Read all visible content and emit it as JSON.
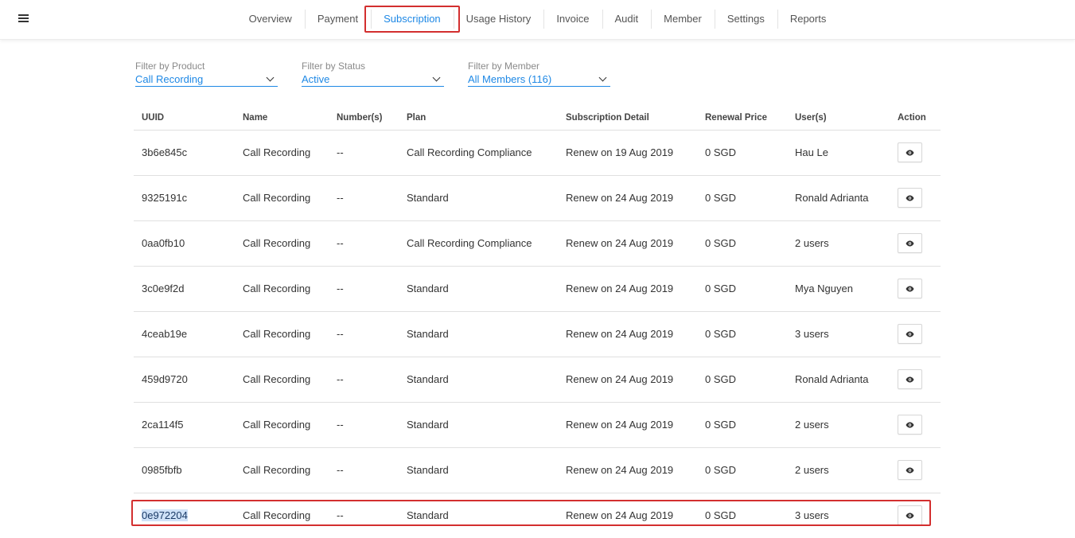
{
  "nav": {
    "tabs": [
      {
        "label": "Overview"
      },
      {
        "label": "Payment"
      },
      {
        "label": "Subscription"
      },
      {
        "label": "Usage History"
      },
      {
        "label": "Invoice"
      },
      {
        "label": "Audit"
      },
      {
        "label": "Member"
      },
      {
        "label": "Settings"
      },
      {
        "label": "Reports"
      }
    ],
    "active_tab": "Subscription"
  },
  "filters": {
    "product": {
      "label": "Filter by Product",
      "value": "Call Recording"
    },
    "status": {
      "label": "Filter by Status",
      "value": "Active"
    },
    "member": {
      "label": "Filter by Member",
      "value": "All Members (116)"
    }
  },
  "table": {
    "headers": {
      "uuid": "UUID",
      "name": "Name",
      "numbers": "Number(s)",
      "plan": "Plan",
      "detail": "Subscription Detail",
      "price": "Renewal Price",
      "users": "User(s)",
      "action": "Action"
    },
    "rows": [
      {
        "uuid": "3b6e845c",
        "name": "Call Recording",
        "numbers": "--",
        "plan": "Call Recording Compliance",
        "detail": "Renew on 19 Aug 2019",
        "price": "0 SGD",
        "users": "Hau Le"
      },
      {
        "uuid": "9325191c",
        "name": "Call Recording",
        "numbers": "--",
        "plan": "Standard",
        "detail": "Renew on 24 Aug 2019",
        "price": "0 SGD",
        "users": "Ronald Adrianta"
      },
      {
        "uuid": "0aa0fb10",
        "name": "Call Recording",
        "numbers": "--",
        "plan": "Call Recording Compliance",
        "detail": "Renew on 24 Aug 2019",
        "price": "0 SGD",
        "users": "2 users"
      },
      {
        "uuid": "3c0e9f2d",
        "name": "Call Recording",
        "numbers": "--",
        "plan": "Standard",
        "detail": "Renew on 24 Aug 2019",
        "price": "0 SGD",
        "users": "Mya Nguyen"
      },
      {
        "uuid": "4ceab19e",
        "name": "Call Recording",
        "numbers": "--",
        "plan": "Standard",
        "detail": "Renew on 24 Aug 2019",
        "price": "0 SGD",
        "users": "3 users"
      },
      {
        "uuid": "459d9720",
        "name": "Call Recording",
        "numbers": "--",
        "plan": "Standard",
        "detail": "Renew on 24 Aug 2019",
        "price": "0 SGD",
        "users": "Ronald Adrianta"
      },
      {
        "uuid": "2ca114f5",
        "name": "Call Recording",
        "numbers": "--",
        "plan": "Standard",
        "detail": "Renew on 24 Aug 2019",
        "price": "0 SGD",
        "users": "2 users"
      },
      {
        "uuid": "0985fbfb",
        "name": "Call Recording",
        "numbers": "--",
        "plan": "Standard",
        "detail": "Renew on 24 Aug 2019",
        "price": "0 SGD",
        "users": "2 users"
      },
      {
        "uuid": "0e972204",
        "name": "Call Recording",
        "numbers": "--",
        "plan": "Standard",
        "detail": "Renew on 24 Aug 2019",
        "price": "0 SGD",
        "users": "3 users"
      }
    ]
  },
  "icons": {
    "menu": "hamburger-menu-icon",
    "view": "eye-icon",
    "dropdown": "chevron-down-icon"
  },
  "colors": {
    "accent": "#1e88e5",
    "highlight": "#d32f2f"
  }
}
